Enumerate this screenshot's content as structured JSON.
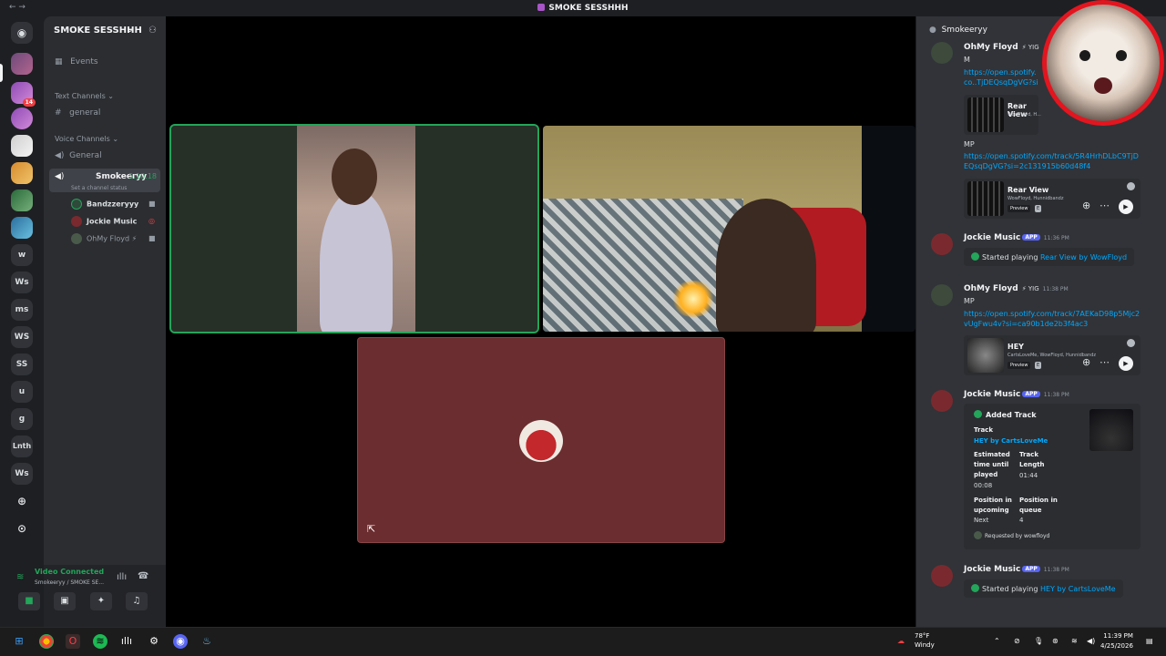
{
  "window": {
    "title": "SMOKE SESSHHH"
  },
  "rail": {
    "badge_count": "14",
    "servers": [
      "w",
      "Ws",
      "ms",
      "WS",
      "SS",
      "u",
      "g",
      "Lnth",
      "Ws"
    ]
  },
  "sidebar": {
    "server_name": "SMOKE SESSHHH",
    "events_label": "Events",
    "text_category": "Text Channels",
    "text_channel": "general",
    "voice_category": "Voice Channels",
    "voice_channel_general": "General",
    "active_voice_channel": "Smokeeryy",
    "active_voice_time": "5:10:18",
    "channel_status_placeholder": "Set a channel status",
    "members": [
      "Bandzzeryyy",
      "Jockie Music",
      "OhMy Floyd"
    ]
  },
  "voice_panel": {
    "status": "Video Connected",
    "location": "Smokeeryy / SMOKE SE..."
  },
  "chat": {
    "channel_name": "Smokeeryy",
    "messages": [
      {
        "author": "OhMy Floyd",
        "tag": "YIG",
        "text": "M",
        "link": "https://open.spotify.co..TjDEQsqDgVG?si=2c...",
        "embed_title": "Rear View",
        "embed_artists": "WowFloyd, H..."
      },
      {
        "text": "MP",
        "link": "https://open.spotify.com/track/5R4HrhDLbC9TjDEQsqDgVG?si=2c131915b60d48f4",
        "embed_title": "Rear View",
        "embed_artists": "WowFloyd, Hunnidbandz"
      },
      {
        "author": "Jockie Music",
        "app": "APP",
        "time": "11:36 PM",
        "now_label": "Started playing",
        "now_song": "Rear View by WowFloyd"
      },
      {
        "author": "OhMy Floyd",
        "tag": "YIG",
        "time": "11:38 PM",
        "text": "MP",
        "link": "https://open.spotify.com/track/7AEKaD98p5Mjc2vUgFwu4v?si=ca90b1de2b3f4ac3",
        "embed_title": "HEY",
        "embed_artists": "CartsLoveMe, WowFloyd, Hunnidbandz"
      },
      {
        "author": "Jockie Music",
        "app": "APP",
        "time": "11:38 PM",
        "card_title": "Added Track",
        "track_label": "Track",
        "track_value": "HEY by CartsLoveMe",
        "est_label_1": "Estimated",
        "est_label_2": "time until",
        "est_label_3": "played",
        "est_value": "00:08",
        "len_label_1": "Track",
        "len_label_2": "Length",
        "len_value": "01:44",
        "pos_next_1": "Position in",
        "pos_next_2": "upcoming",
        "pos_next_value": "Next",
        "pos_q_1": "Position in",
        "pos_q_2": "queue",
        "pos_q_value": "4",
        "requested": "Requested by wowfloyd"
      },
      {
        "author": "Jockie Music",
        "app": "APP",
        "time": "11:38 PM",
        "now_label": "Started playing",
        "now_song": "HEY by CartsLoveMe"
      }
    ],
    "preview_label": "Preview",
    "explicit_label": "E"
  },
  "taskbar": {
    "weather_temp": "78°F",
    "weather_desc": "Windy",
    "time": "11:39 PM",
    "date": "4/25/2026"
  }
}
